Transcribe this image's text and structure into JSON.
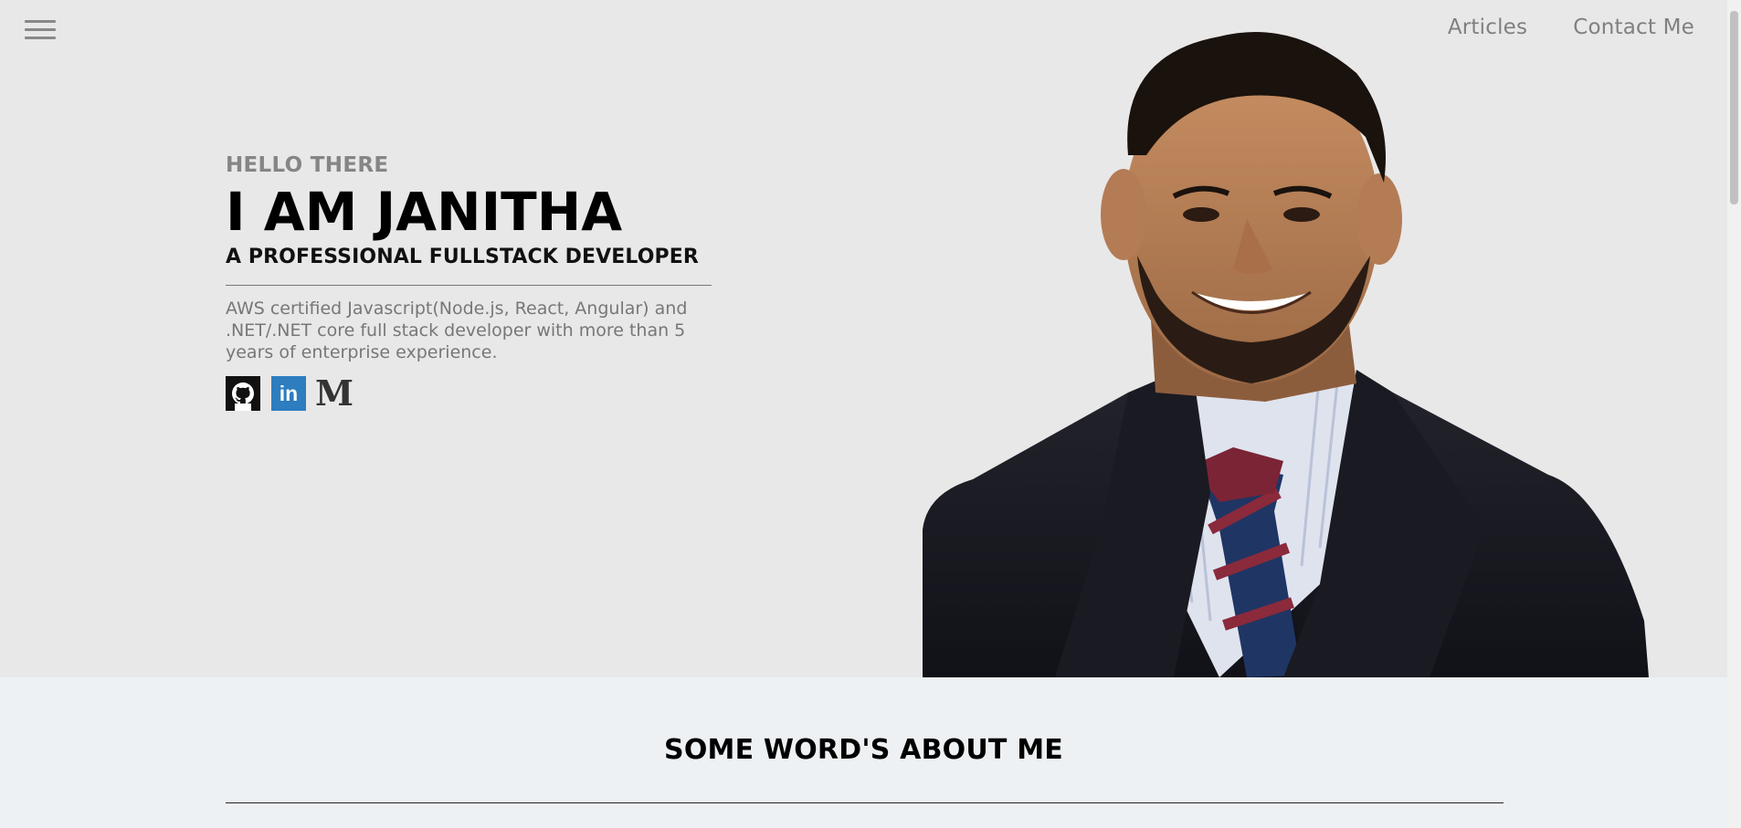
{
  "nav": {
    "menu_icon": "hamburger-menu-icon",
    "items": [
      {
        "label": "Articles"
      },
      {
        "label": "Contact Me"
      }
    ]
  },
  "hero": {
    "greeting": "HELLO THERE",
    "name": "I AM JANITHA",
    "role": "A PROFESSIONAL FULLSTACK DEVELOPER",
    "bio": "AWS certified Javascript(Node.js, React, Angular) and .NET/.NET core full stack developer with more than 5 years of enterprise experience.",
    "socials": [
      {
        "icon": "github-icon",
        "label": ""
      },
      {
        "icon": "linkedin-icon",
        "label": "in"
      },
      {
        "icon": "medium-icon",
        "label": "M"
      }
    ],
    "portrait": "portrait-photo"
  },
  "about": {
    "heading": "SOME WORD'S ABOUT ME"
  },
  "colors": {
    "hero_bg": "#e9e8e8",
    "about_bg": "#eef1f3",
    "linkedin": "#2d7dbf",
    "nav_text": "#808080"
  }
}
